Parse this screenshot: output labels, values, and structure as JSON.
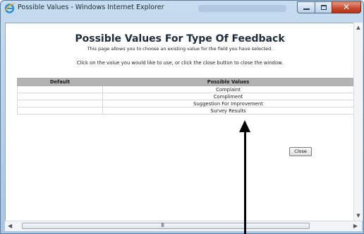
{
  "window": {
    "title": "Possible Values - Windows Internet Explorer",
    "close_glyph": "✕",
    "controls": [
      "minimize-icon",
      "maximize-icon",
      "close-icon"
    ]
  },
  "page": {
    "title": "Possible Values For Type Of Feedback",
    "subtitle": "This page allows you to choose an existing value for the field you have selected.",
    "instruction": "Click on the value you would like to use, or click the close button to close the window."
  },
  "table": {
    "headers": [
      "Default",
      "Possible Values"
    ],
    "rows": [
      {
        "default": "",
        "value": "Complaint"
      },
      {
        "default": "",
        "value": "Compliment"
      },
      {
        "default": "",
        "value": "Suggestion For Improvement"
      },
      {
        "default": "",
        "value": "Survey Results"
      }
    ]
  },
  "close_button": {
    "label": "Close"
  },
  "scrollbar": {
    "grip": "III"
  },
  "colors": {
    "header_bg": "#b3b3b3",
    "window_frame": "#a9c6e4",
    "close_red": "#c54a2e"
  }
}
